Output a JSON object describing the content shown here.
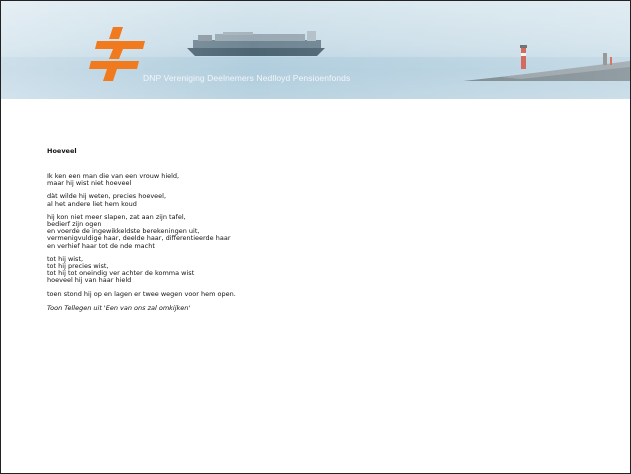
{
  "header": {
    "site_title": "DNP Vereniging Deelnemers Nedlloyd Pensioenfonds",
    "colors": {
      "logo": "#f27a1e",
      "sky": "#c9dde8",
      "title_text": "#f2f6f8"
    }
  },
  "poem": {
    "title": "Hoeveel",
    "stanzas": [
      {
        "lines": [
          "Ik ken een man die van een vrouw hield,",
          "maar hij wist niet hoeveel"
        ]
      },
      {
        "lines": [
          "dàt wilde hij weten, precies hoeveel,",
          "al het andere liet hem koud"
        ]
      },
      {
        "lines": [
          "hij kon niet meer slapen, zat aan zijn tafel,",
          "bedierf zijn ogen",
          "en voerde de ingewikkeldste berekeningen uit,",
          "vermenigvuldige haar, deelde haar, differentieerde haar",
          "en verhief haar tot de nde macht"
        ]
      },
      {
        "lines": [
          "tot hij wist,",
          "tot hij precies wist,",
          "tot hij tot oneindig ver achter de komma wist",
          "hoeveel hij van haar hield"
        ]
      },
      {
        "lines": [
          "toen stond hij op en lagen er twee wegen voor hem open."
        ]
      }
    ],
    "attribution": "Toon Tellegen uit 'Een van ons zal omkijken'"
  }
}
